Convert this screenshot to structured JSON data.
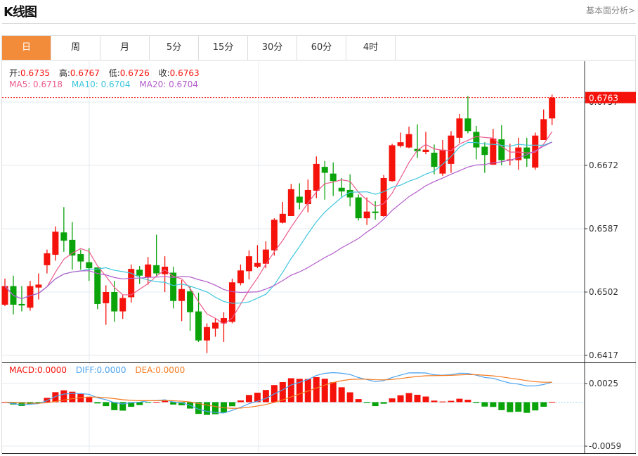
{
  "header": {
    "title": "K线图",
    "more_link": "基本面分析>"
  },
  "tabs": [
    {
      "label": "日",
      "active": true
    },
    {
      "label": "周"
    },
    {
      "label": "月"
    },
    {
      "label": "5分"
    },
    {
      "label": "15分"
    },
    {
      "label": "30分"
    },
    {
      "label": "60分"
    },
    {
      "label": "4时"
    }
  ],
  "ohlc_legend": {
    "open_label": "开:",
    "open": "0.6735",
    "high_label": "高:",
    "high": "0.6767",
    "low_label": "低:",
    "low": "0.6726",
    "close_label": "收:",
    "close": "0.6763"
  },
  "ma_legend": {
    "ma5": "MA5: 0.6718",
    "ma10": "MA10: 0.6704",
    "ma20": "MA20: 0.6704"
  },
  "macd_legend": {
    "macd": "MACD:0.0000",
    "diff": "DIFF:0.0000",
    "dea": "DEA:0.0000"
  },
  "colors": {
    "up": "#f5120a",
    "down": "#0aa30a",
    "ma5": "#ec5b8e",
    "ma10": "#3ec6dc",
    "ma20": "#b35ccb",
    "diff": "#4aa3f0",
    "dea": "#f57a1f",
    "accent": "#f28b3a"
  },
  "chart_data": {
    "type": "candlestick",
    "price_axis_ticks": [
      "0.6757",
      "0.6672",
      "0.6587",
      "0.6502",
      "0.6417"
    ],
    "current_price": "0.6763",
    "macd_axis_ticks": [
      "0.0025",
      "-0.0059"
    ],
    "grid": true,
    "candles_ohlc_note": "[open, close, high, low]",
    "candles": [
      [
        0.6485,
        0.651,
        0.652,
        0.6483
      ],
      [
        0.651,
        0.6485,
        0.6524,
        0.6472
      ],
      [
        0.6486,
        0.6484,
        0.651,
        0.6476
      ],
      [
        0.6481,
        0.651,
        0.6517,
        0.6477
      ],
      [
        0.6508,
        0.6512,
        0.6527,
        0.6492
      ],
      [
        0.6538,
        0.6554,
        0.6559,
        0.6527
      ],
      [
        0.6552,
        0.6583,
        0.659,
        0.6544
      ],
      [
        0.6582,
        0.6571,
        0.6616,
        0.6556
      ],
      [
        0.6572,
        0.6551,
        0.6596,
        0.6532
      ],
      [
        0.6553,
        0.6543,
        0.6559,
        0.6532
      ],
      [
        0.6542,
        0.6534,
        0.6561,
        0.6517
      ],
      [
        0.6535,
        0.6486,
        0.6535,
        0.6479
      ],
      [
        0.6487,
        0.6502,
        0.6511,
        0.6458
      ],
      [
        0.6502,
        0.6476,
        0.6517,
        0.6462
      ],
      [
        0.6476,
        0.6494,
        0.6498,
        0.6466
      ],
      [
        0.6495,
        0.6533,
        0.6539,
        0.6488
      ],
      [
        0.6532,
        0.6524,
        0.6537,
        0.6513
      ],
      [
        0.6522,
        0.6539,
        0.6549,
        0.6512
      ],
      [
        0.6538,
        0.6527,
        0.6579,
        0.6524
      ],
      [
        0.6526,
        0.6536,
        0.655,
        0.6502
      ],
      [
        0.6528,
        0.649,
        0.6536,
        0.648
      ],
      [
        0.649,
        0.6506,
        0.6518,
        0.6463
      ],
      [
        0.6503,
        0.6475,
        0.651,
        0.645
      ],
      [
        0.6476,
        0.6437,
        0.6501,
        0.6435
      ],
      [
        0.6437,
        0.6455,
        0.646,
        0.642
      ],
      [
        0.6453,
        0.6461,
        0.6467,
        0.6442
      ],
      [
        0.646,
        0.6467,
        0.6475,
        0.6435
      ],
      [
        0.6462,
        0.6515,
        0.652,
        0.646
      ],
      [
        0.6514,
        0.6531,
        0.6539,
        0.6511
      ],
      [
        0.653,
        0.655,
        0.6558,
        0.6519
      ],
      [
        0.6536,
        0.6541,
        0.6565,
        0.6534
      ],
      [
        0.654,
        0.6559,
        0.657,
        0.6534
      ],
      [
        0.6558,
        0.6599,
        0.6601,
        0.6551
      ],
      [
        0.6595,
        0.6607,
        0.6623,
        0.6594
      ],
      [
        0.6604,
        0.664,
        0.6647,
        0.6604
      ],
      [
        0.663,
        0.6622,
        0.6648,
        0.6613
      ],
      [
        0.662,
        0.6639,
        0.6653,
        0.6609
      ],
      [
        0.6638,
        0.6674,
        0.6684,
        0.6628
      ],
      [
        0.667,
        0.6662,
        0.6678,
        0.6626
      ],
      [
        0.6661,
        0.6651,
        0.6676,
        0.6631
      ],
      [
        0.6642,
        0.6637,
        0.6655,
        0.663
      ],
      [
        0.6639,
        0.6629,
        0.666,
        0.6617
      ],
      [
        0.6629,
        0.6601,
        0.6633,
        0.6598
      ],
      [
        0.6601,
        0.661,
        0.6629,
        0.6592
      ],
      [
        0.661,
        0.6608,
        0.6624,
        0.6599
      ],
      [
        0.6604,
        0.6655,
        0.6659,
        0.6603
      ],
      [
        0.6651,
        0.6699,
        0.6701,
        0.665
      ],
      [
        0.6698,
        0.6703,
        0.6716,
        0.6696
      ],
      [
        0.6696,
        0.6714,
        0.6724,
        0.6695
      ],
      [
        0.6694,
        0.6691,
        0.6727,
        0.6682
      ],
      [
        0.669,
        0.6693,
        0.6717,
        0.6687
      ],
      [
        0.6689,
        0.667,
        0.67,
        0.666
      ],
      [
        0.6661,
        0.6693,
        0.6706,
        0.6658
      ],
      [
        0.6674,
        0.6712,
        0.6718,
        0.6662
      ],
      [
        0.6709,
        0.6735,
        0.6741,
        0.6702
      ],
      [
        0.6735,
        0.6718,
        0.6765,
        0.6715
      ],
      [
        0.6717,
        0.6696,
        0.6725,
        0.668
      ],
      [
        0.6697,
        0.6686,
        0.6703,
        0.6662
      ],
      [
        0.6673,
        0.6708,
        0.6721,
        0.6673
      ],
      [
        0.6707,
        0.6679,
        0.6726,
        0.6672
      ],
      [
        0.6679,
        0.668,
        0.6701,
        0.6672
      ],
      [
        0.6679,
        0.6696,
        0.6709,
        0.6666
      ],
      [
        0.6696,
        0.6681,
        0.6709,
        0.667
      ],
      [
        0.6669,
        0.6712,
        0.6716,
        0.6666
      ],
      [
        0.6706,
        0.6734,
        0.6747,
        0.6706
      ],
      [
        0.6735,
        0.6763,
        0.6767,
        0.6726
      ]
    ]
  }
}
